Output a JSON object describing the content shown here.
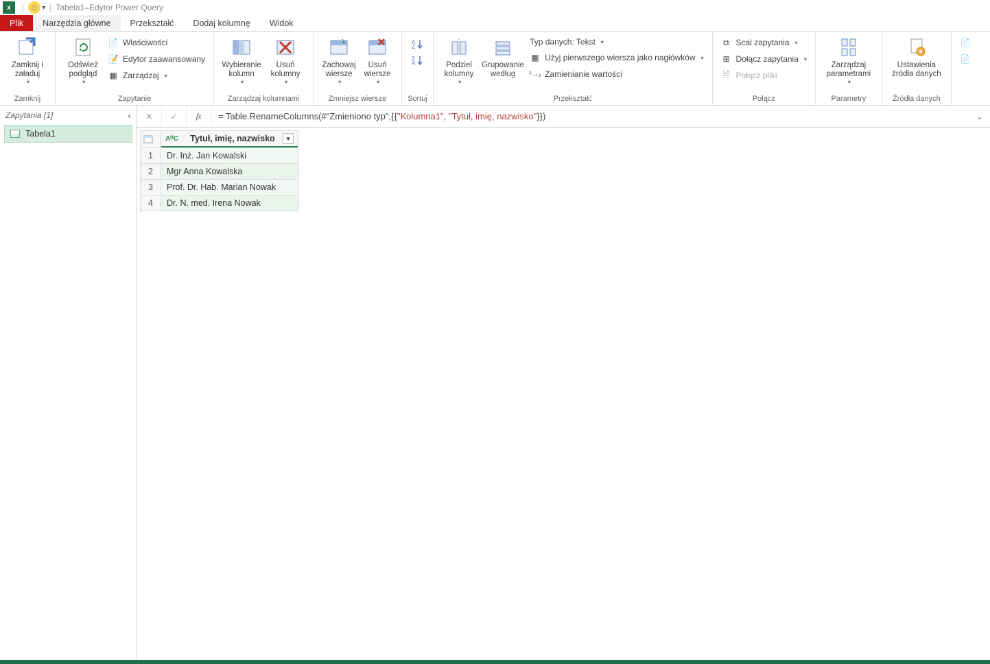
{
  "title": "Tabela1–Edytor Power Query",
  "app_icon_letter": "x",
  "tabs": {
    "file": "Plik",
    "home": "Narzędzia główne",
    "transform": "Przekształć",
    "addcol": "Dodaj kolumnę",
    "view": "Widok"
  },
  "ribbon": {
    "close": {
      "label": "Zamknij",
      "btn": "Zamknij i\nzaładuj"
    },
    "query": {
      "label": "Zapytanie",
      "refresh": "Odśwież\npodgląd",
      "properties": "Właściwości",
      "adv_editor": "Edytor zaawansowany",
      "manage": "Zarządzaj"
    },
    "cols": {
      "label": "Zarządzaj kolumnami",
      "choose": "Wybieranie\nkolumn",
      "remove": "Usuń\nkolumny"
    },
    "rows": {
      "label": "Zmniejsz wiersze",
      "keep": "Zachowaj\nwiersze",
      "remove": "Usuń\nwiersze"
    },
    "sort": {
      "label": "Sortuj"
    },
    "transform": {
      "label": "Przekształć",
      "split": "Podziel\nkolumny",
      "group": "Grupowanie\nwedług",
      "dtype": "Typ danych: Tekst",
      "first_row": "Użyj pierwszego wiersza jako nagłówków",
      "replace": "Zamienianie wartości"
    },
    "combine": {
      "label": "Połącz",
      "merge": "Scal zapytania",
      "append": "Dołącz zapytania",
      "combine_files": "Połącz pliki"
    },
    "params": {
      "label": "Parametry",
      "btn": "Zarządzaj\nparametrami"
    },
    "sources": {
      "label": "Źródła danych",
      "btn": "Ustawienia\nźródła danych"
    }
  },
  "sidebar": {
    "header": "Zapytania [1]",
    "item": "Tabela1"
  },
  "formula": {
    "prefix": "= Table.RenameColumns(#\"Zmieniono typ\",{{",
    "s1": "\"Kolumna1\"",
    "mid": ", ",
    "s2": "\"Tytuł, imię, nazwisko\"",
    "suffix": "}})"
  },
  "grid": {
    "col_header": "Tytuł, imię, nazwisko",
    "type_icon": "AᴮC",
    "rows": [
      "Dr. Inż. Jan Kowalski",
      "Mgr Anna Kowalska",
      "Prof. Dr. Hab. Marian Nowak",
      "Dr. N. med. Irena Nowak"
    ]
  }
}
